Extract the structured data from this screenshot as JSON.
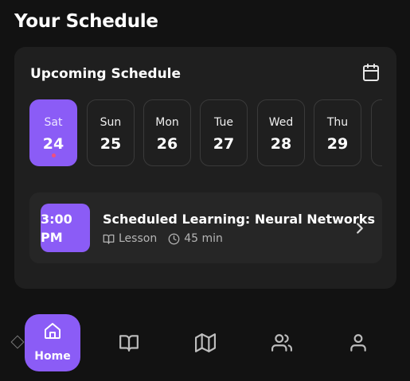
{
  "header": {
    "title": "Your Schedule"
  },
  "schedule": {
    "title": "Upcoming Schedule",
    "days": [
      {
        "name": "Sat",
        "num": "24",
        "active": true
      },
      {
        "name": "Sun",
        "num": "25"
      },
      {
        "name": "Mon",
        "num": "26"
      },
      {
        "name": "Tue",
        "num": "27"
      },
      {
        "name": "Wed",
        "num": "28"
      },
      {
        "name": "Thu",
        "num": "29"
      }
    ],
    "event": {
      "time_line1": "3:00",
      "time_line2": "PM",
      "title": "Scheduled Learning: Neural Networks",
      "type": "Lesson",
      "duration": "45 min"
    }
  },
  "nav": {
    "home_label": "Home"
  },
  "colors": {
    "accent": "#8b5cf6",
    "background": "#121212",
    "card": "#1f1f1f",
    "dot": "#ef4f7e"
  }
}
